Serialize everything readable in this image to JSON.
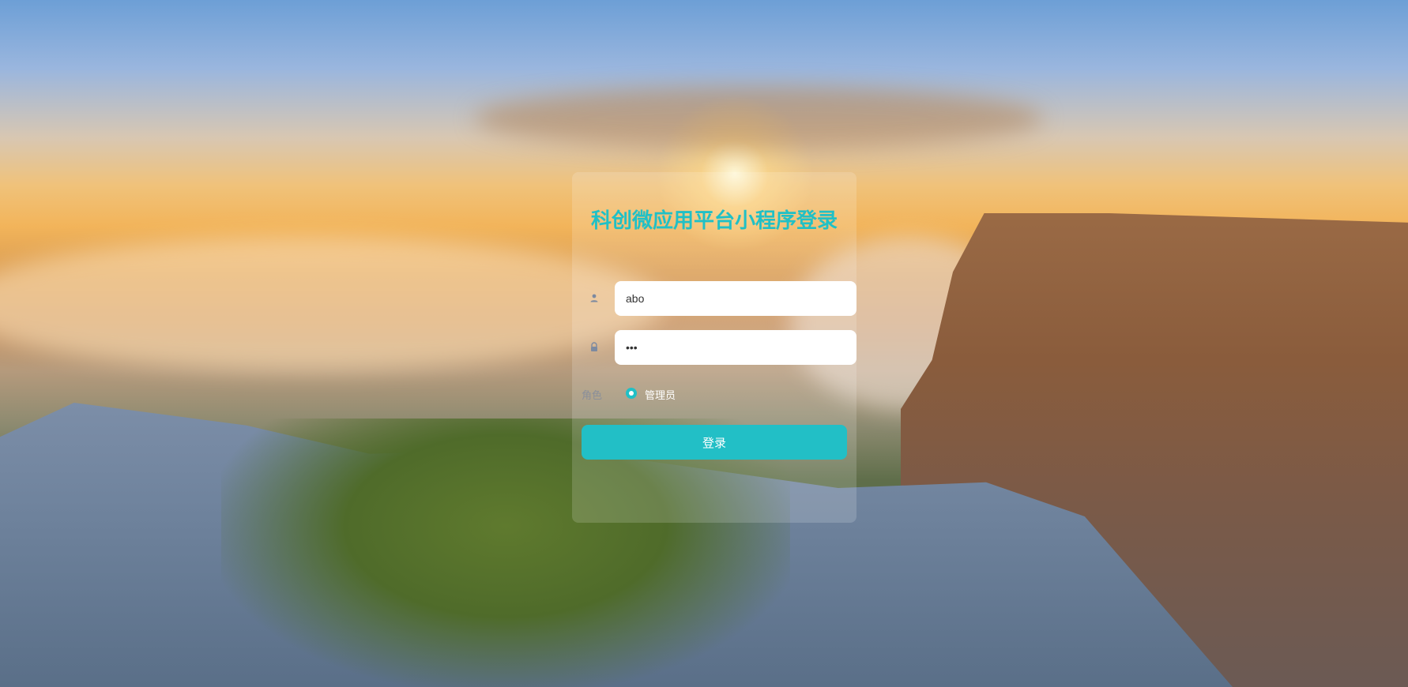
{
  "login": {
    "title": "科创微应用平台小程序登录",
    "username": {
      "icon": "user-icon",
      "value": "abo"
    },
    "password": {
      "icon": "lock-icon",
      "value": "•••"
    },
    "role": {
      "label": "角色",
      "options": [
        {
          "label": "管理员",
          "selected": true
        }
      ]
    },
    "submit_label": "登录"
  },
  "colors": {
    "accent": "#22bfc6",
    "title": "#20c0c6"
  }
}
